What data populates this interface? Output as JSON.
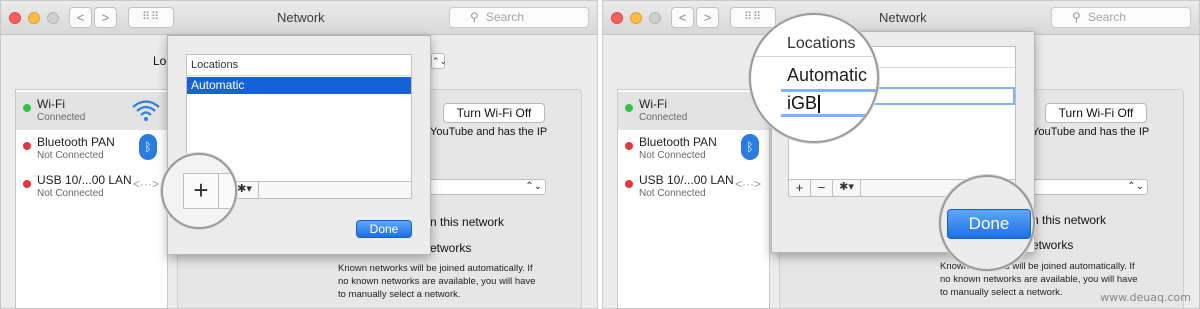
{
  "window": {
    "title": "Network",
    "search_placeholder": "Search",
    "back_glyph": "<",
    "forward_glyph": ">",
    "grid_glyph": "⠿⠿",
    "search_glyph": "⚲",
    "location_label_partial": "Loc",
    "location_popup_arrow": "⌃⌄"
  },
  "sidebar": {
    "items": [
      {
        "name": "Wi-Fi",
        "status": "Connected",
        "dot_color": "#33c24c",
        "icon": "wifi-icon"
      },
      {
        "name": "Bluetooth PAN",
        "status": "Not Connected",
        "dot_color": "#e8343a",
        "icon": "bluetooth-icon"
      },
      {
        "name": "USB 10/...00 LAN",
        "status": "Not Connected",
        "dot_color": "#e8343a",
        "icon": "ethernet-icon"
      }
    ]
  },
  "content": {
    "turn_wifi_off": "Turn Wi-Fi Off",
    "status_partial": "YouTube and has the IP",
    "network_name_popup": "",
    "ask_join_partial": "n this network",
    "known_networks_partial": "etworks",
    "known_networks_text": "Known networks will be joined automatically. If no known networks are available, you will have to manually select a network.",
    "known_networks_lines": [
      "Known networks will be joined automatically. If",
      "no known networks are available, you will have",
      "to manually select a network."
    ]
  },
  "sheet": {
    "locations_header": "Locations",
    "items": [
      "Automatic"
    ],
    "new_location_value": "iGB",
    "add_button": "+",
    "remove_button": "−",
    "gear_button": "✱▾",
    "done_button": "Done"
  },
  "watermark": "www.deuaq.com",
  "colors": {
    "accent": "#1562d6",
    "connected": "#33c24c",
    "disconnected": "#e8343a"
  }
}
